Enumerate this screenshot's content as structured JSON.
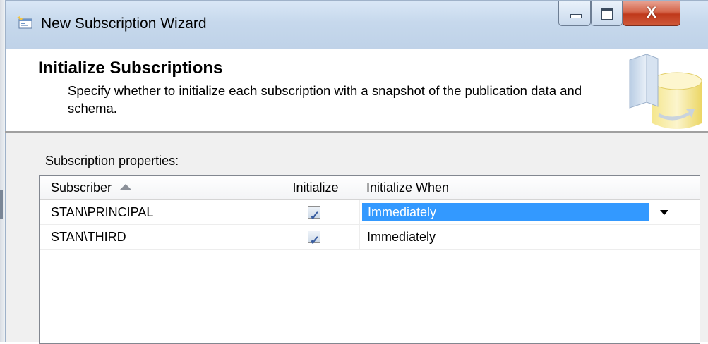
{
  "window": {
    "title": "New Subscription Wizard",
    "close_glyph": "X"
  },
  "header": {
    "title": "Initialize Subscriptions",
    "description": "Specify whether to initialize each subscription with a snapshot of the publication data and schema."
  },
  "properties": {
    "label": "Subscription properties:",
    "columns": [
      "Subscriber",
      "Initialize",
      "Initialize When"
    ],
    "rows": [
      {
        "subscriber": "STAN\\PRINCIPAL",
        "initialize": true,
        "when": "Immediately",
        "selected": true
      },
      {
        "subscriber": "STAN\\THIRD",
        "initialize": true,
        "when": "Immediately",
        "selected": false
      }
    ]
  },
  "colors": {
    "selection": "#3399ff",
    "titlebar": "#c6d8ec",
    "close_button": "#c0391c",
    "panel": "#f0f0f0"
  },
  "icons": [
    "wizard-app-icon",
    "minimize-icon",
    "maximize-icon",
    "close-icon",
    "database-book-icon",
    "sort-ascending-icon",
    "checkbox-checked-icon",
    "dropdown-arrow-icon"
  ]
}
